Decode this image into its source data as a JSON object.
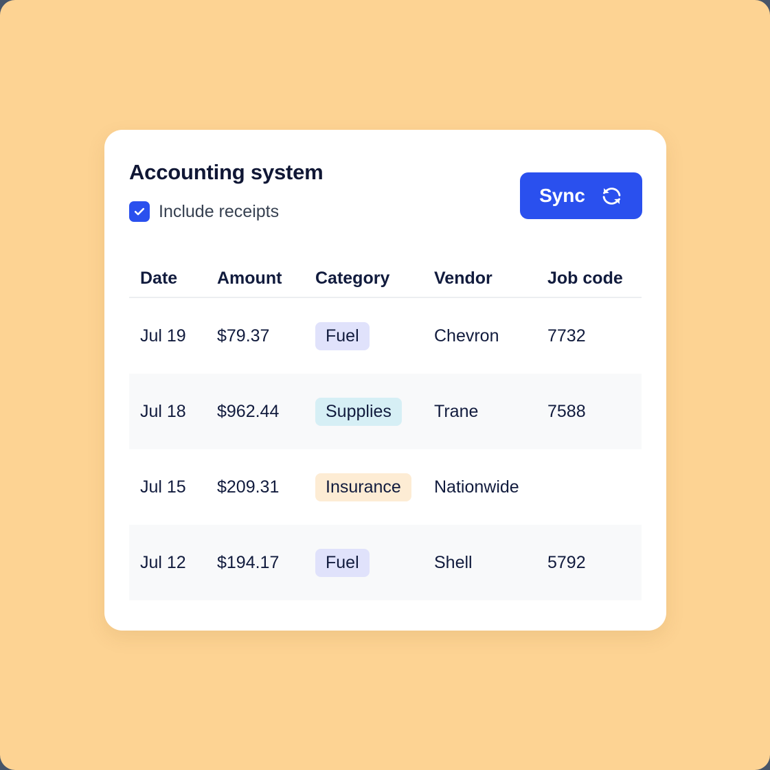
{
  "card": {
    "title": "Accounting system",
    "checkbox": {
      "label": "Include receipts",
      "checked": true,
      "icon": "checkmark-icon",
      "color": "#2a50ee"
    },
    "sync_button": {
      "label": "Sync",
      "icon": "sync-refresh-icon",
      "color": "#2a50ee"
    }
  },
  "table": {
    "columns": [
      "Date",
      "Amount",
      "Category",
      "Vendor",
      "Job code"
    ],
    "rows": [
      {
        "date": "Jul 19",
        "amount": "$79.37",
        "category": "Fuel",
        "category_color": "#e0e2fb",
        "vendor": "Chevron",
        "job_code": "7732",
        "striped": false
      },
      {
        "date": "Jul 18",
        "amount": "$962.44",
        "category": "Supplies",
        "category_color": "#d6eff5",
        "vendor": "Trane",
        "job_code": "7588",
        "striped": true
      },
      {
        "date": "Jul 15",
        "amount": "$209.31",
        "category": "Insurance",
        "category_color": "#fdecd4",
        "vendor": "Nationwide",
        "job_code": "",
        "striped": false
      },
      {
        "date": "Jul 12",
        "amount": "$194.17",
        "category": "Fuel",
        "category_color": "#e0e2fb",
        "vendor": "Shell",
        "job_code": "5792",
        "striped": true
      }
    ]
  },
  "theme": {
    "background": "#fdd393",
    "card_background": "#ffffff",
    "text": "#111b3d",
    "accent": "#2a50ee",
    "stripe": "#f8f9fa",
    "divider": "#eceef1"
  }
}
